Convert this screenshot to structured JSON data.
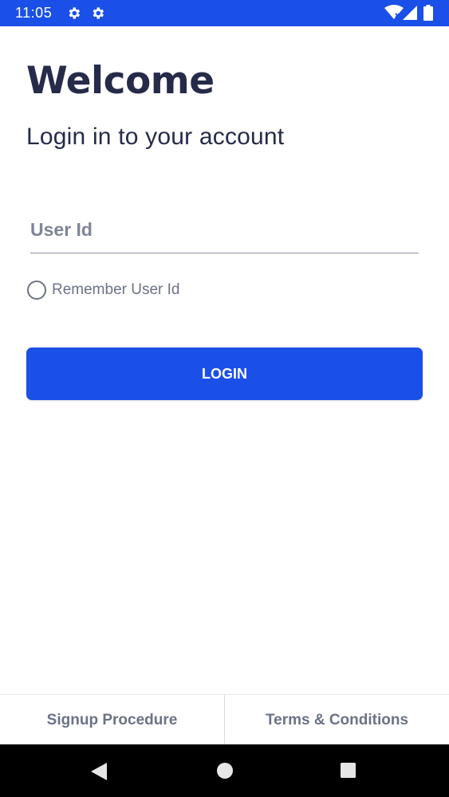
{
  "status_bar": {
    "time": "11:05",
    "icons": [
      "gear-icon",
      "gear-icon",
      "wifi-icon",
      "signal-icon",
      "battery-icon"
    ]
  },
  "header": {
    "title": "Welcome",
    "subtitle": "Login in to your account"
  },
  "form": {
    "user_id_placeholder": "User Id",
    "user_id_value": "",
    "remember_label": "Remember User Id",
    "remember_checked": false,
    "login_label": "LOGIN"
  },
  "footer": {
    "links": [
      {
        "label": "Signup Procedure"
      },
      {
        "label": "Terms & Conditions"
      }
    ]
  },
  "navigation": {
    "icons": [
      "back-icon",
      "home-icon",
      "recents-icon"
    ]
  },
  "colors": {
    "accent": "#1a4fe8",
    "heading": "#262b4a",
    "muted": "#6c7286"
  }
}
